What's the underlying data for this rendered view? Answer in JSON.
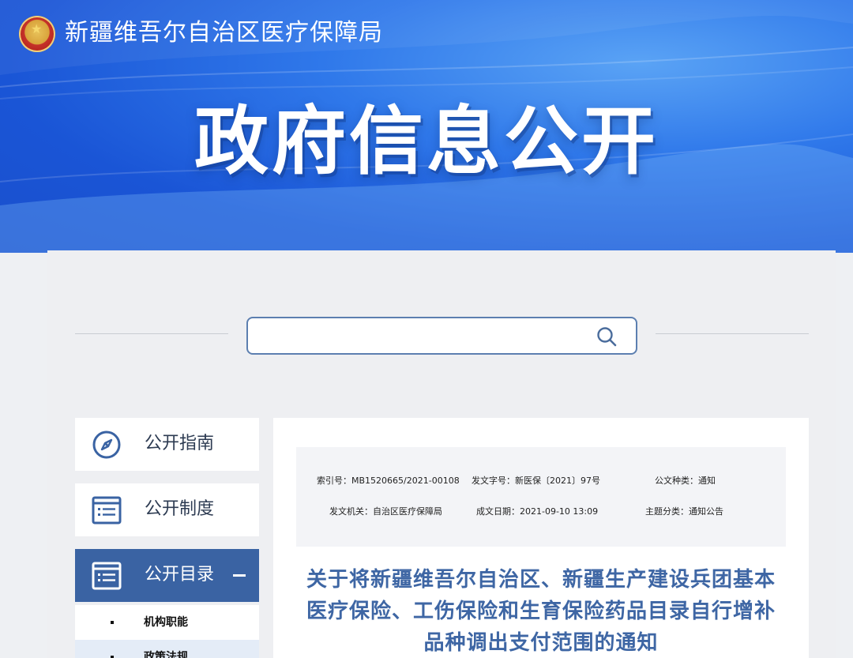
{
  "header": {
    "site_title": "新疆维吾尔自治区医疗保障局",
    "hero_title": "政府信息公开"
  },
  "search": {
    "placeholder": "",
    "value": ""
  },
  "sidebar": {
    "items": [
      {
        "label": "公开指南",
        "icon": "compass-icon",
        "active": false
      },
      {
        "label": "公开制度",
        "icon": "list-icon",
        "active": false
      },
      {
        "label": "公开目录",
        "icon": "list-icon",
        "active": true,
        "expanded": true
      }
    ],
    "sub_items": [
      {
        "label": "机构职能"
      },
      {
        "label": "政策法规"
      }
    ]
  },
  "document": {
    "meta": {
      "index_label": "索引号：MB1520665/2021-00108",
      "doc_number_label": "发文字号：新医保〔2021〕97号",
      "type_label": "公文种类：通知",
      "issuer_label": "发文机关：自治区医疗保障局",
      "date_label": "成文日期：2021-09-10 13:09",
      "topic_label": "主题分类：通知公告"
    },
    "title_lines": [
      "关于将新疆维吾尔自治区、新疆生产建设兵团基本",
      "医疗保险、工伤保险和生育保险药品目录自行增补",
      "品种调出支付范围的通知"
    ]
  },
  "colors": {
    "banner_blue": "#1a55d6",
    "active_nav": "#3a63a3",
    "title_blue": "#3e66a4",
    "search_border": "#5c7fb0"
  }
}
